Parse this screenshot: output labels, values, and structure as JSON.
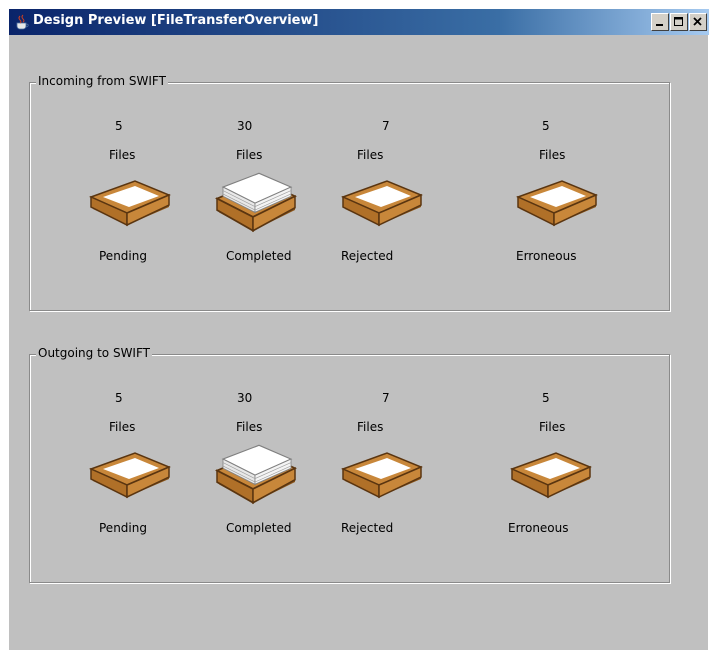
{
  "window": {
    "title": "Design Preview [FileTransferOverview]",
    "controls": [
      "minimize",
      "maximize",
      "close"
    ]
  },
  "incoming": {
    "title": "Incoming from SWIFT",
    "bins": [
      {
        "count": "5",
        "unit": "Files",
        "label": "Pending",
        "icon": "empty-tray"
      },
      {
        "count": "30",
        "unit": "Files",
        "label": "Completed",
        "icon": "full-tray"
      },
      {
        "count": "7",
        "unit": "Files",
        "label": "Rejected",
        "icon": "empty-tray"
      },
      {
        "count": "5",
        "unit": "Files",
        "label": "Erroneous",
        "icon": "empty-tray"
      }
    ]
  },
  "outgoing": {
    "title": "Outgoing to SWIFT",
    "bins": [
      {
        "count": "5",
        "unit": "Files",
        "label": "Pending",
        "icon": "empty-tray"
      },
      {
        "count": "30",
        "unit": "Files",
        "label": "Completed",
        "icon": "full-tray"
      },
      {
        "count": "7",
        "unit": "Files",
        "label": "Rejected",
        "icon": "empty-tray"
      },
      {
        "count": "5",
        "unit": "Files",
        "label": "Erroneous",
        "icon": "empty-tray"
      }
    ]
  },
  "colors": {
    "tray": "#c8873a",
    "tray_dark": "#8a5418",
    "paper": "#ffffff",
    "titlebar_start": "#0a246a",
    "titlebar_end": "#a6caf0"
  }
}
